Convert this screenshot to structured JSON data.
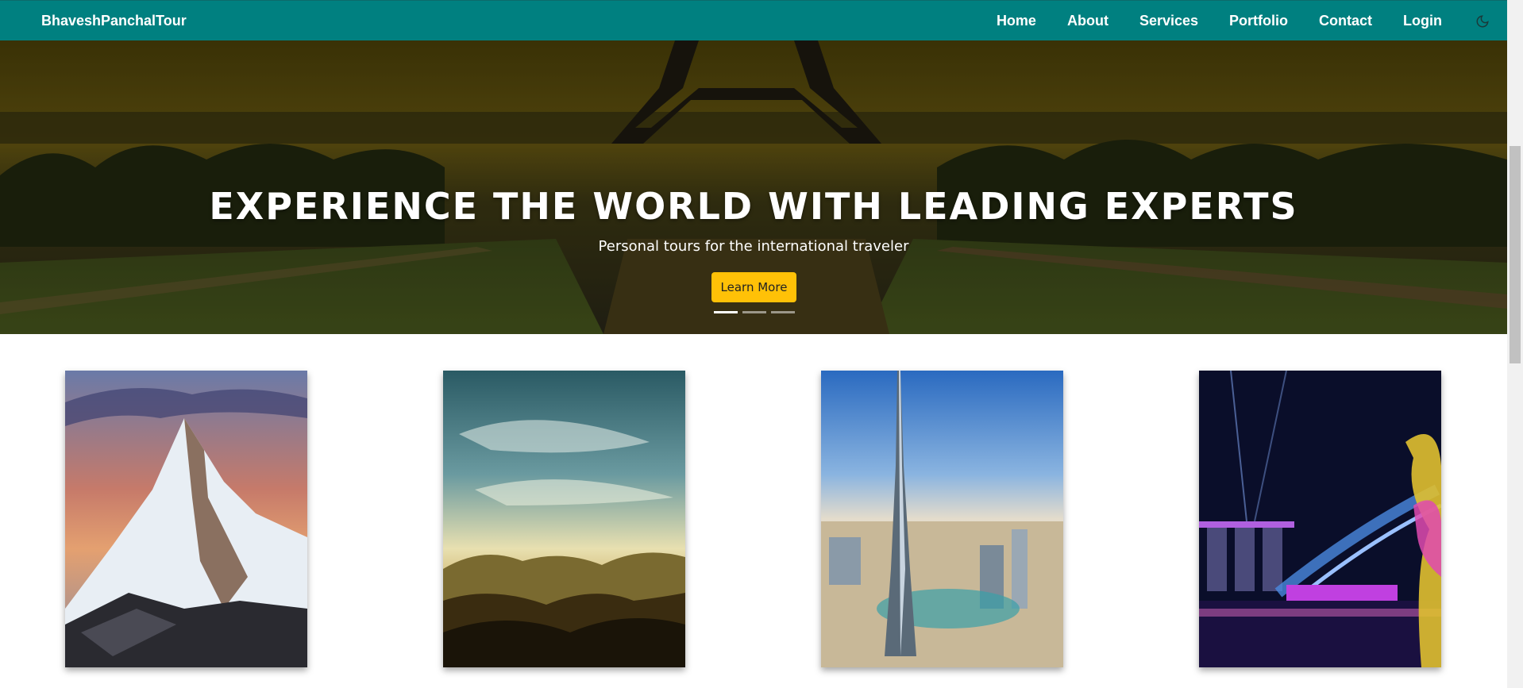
{
  "navbar": {
    "brand": "BhaveshPanchalTour",
    "links": [
      "Home",
      "About",
      "Services",
      "Portfolio",
      "Contact",
      "Login"
    ],
    "theme_toggle_icon": "moon-icon",
    "background": "#008080"
  },
  "hero": {
    "title": "EXPERIENCE THE WORLD WITH LEADING EXPERTS",
    "subtitle": "Personal tours for the international traveler",
    "button_label": "Learn More",
    "button_color": "#ffc107",
    "carousel_slides": 3,
    "active_slide": 1
  },
  "gallery": {
    "cards": [
      {
        "image": "snow-mountain-sunset"
      },
      {
        "image": "sky-over-hills"
      },
      {
        "image": "dubai-skyscraper"
      },
      {
        "image": "singapore-night-lights"
      }
    ]
  }
}
